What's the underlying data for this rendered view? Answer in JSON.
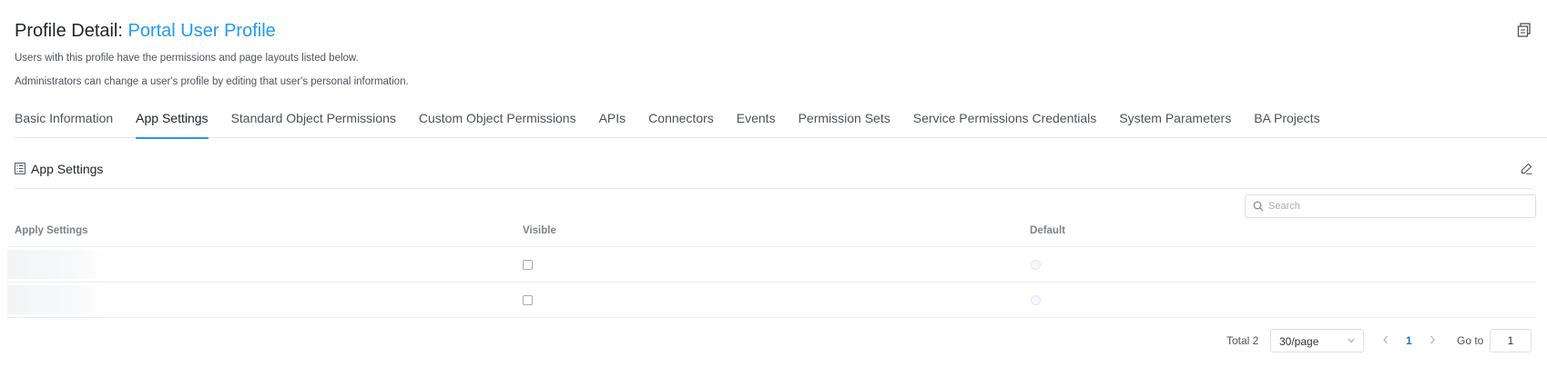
{
  "header": {
    "title_prefix": "Profile Detail:",
    "profile_name": "Portal User Profile",
    "description_1": "Users with this profile have the permissions and page layouts listed below.",
    "description_2": "Administrators can change a user's profile by editing that user's personal information."
  },
  "tabs": [
    {
      "label": "Basic Information",
      "active": false
    },
    {
      "label": "App Settings",
      "active": true
    },
    {
      "label": "Standard Object Permissions",
      "active": false
    },
    {
      "label": "Custom Object Permissions",
      "active": false
    },
    {
      "label": "APIs",
      "active": false
    },
    {
      "label": "Connectors",
      "active": false
    },
    {
      "label": "Events",
      "active": false
    },
    {
      "label": "Permission Sets",
      "active": false
    },
    {
      "label": "Service Permissions Credentials",
      "active": false
    },
    {
      "label": "System Parameters",
      "active": false
    },
    {
      "label": "BA Projects",
      "active": false
    }
  ],
  "section": {
    "title": "App Settings"
  },
  "search": {
    "placeholder": "Search",
    "value": ""
  },
  "table": {
    "columns": [
      "Apply Settings",
      "Visible",
      "Default"
    ],
    "rows": [
      {
        "name": "",
        "visible": false,
        "default": false
      },
      {
        "name": "",
        "visible": false,
        "default": false
      }
    ]
  },
  "pagination": {
    "total_label": "Total 2",
    "page_size": "30/page",
    "current_page": "1",
    "goto_label": "Go to",
    "goto_value": "1"
  },
  "colors": {
    "accent": "#1f9bf0",
    "active_page": "#1f6fd4",
    "border": "#e4e7ed"
  },
  "icons": {
    "copy": "copy-icon",
    "section": "list-icon",
    "edit": "edit-icon",
    "search": "search-icon",
    "prev": "chevron-left-icon",
    "next": "chevron-right-icon",
    "dropdown": "chevron-down-icon"
  }
}
